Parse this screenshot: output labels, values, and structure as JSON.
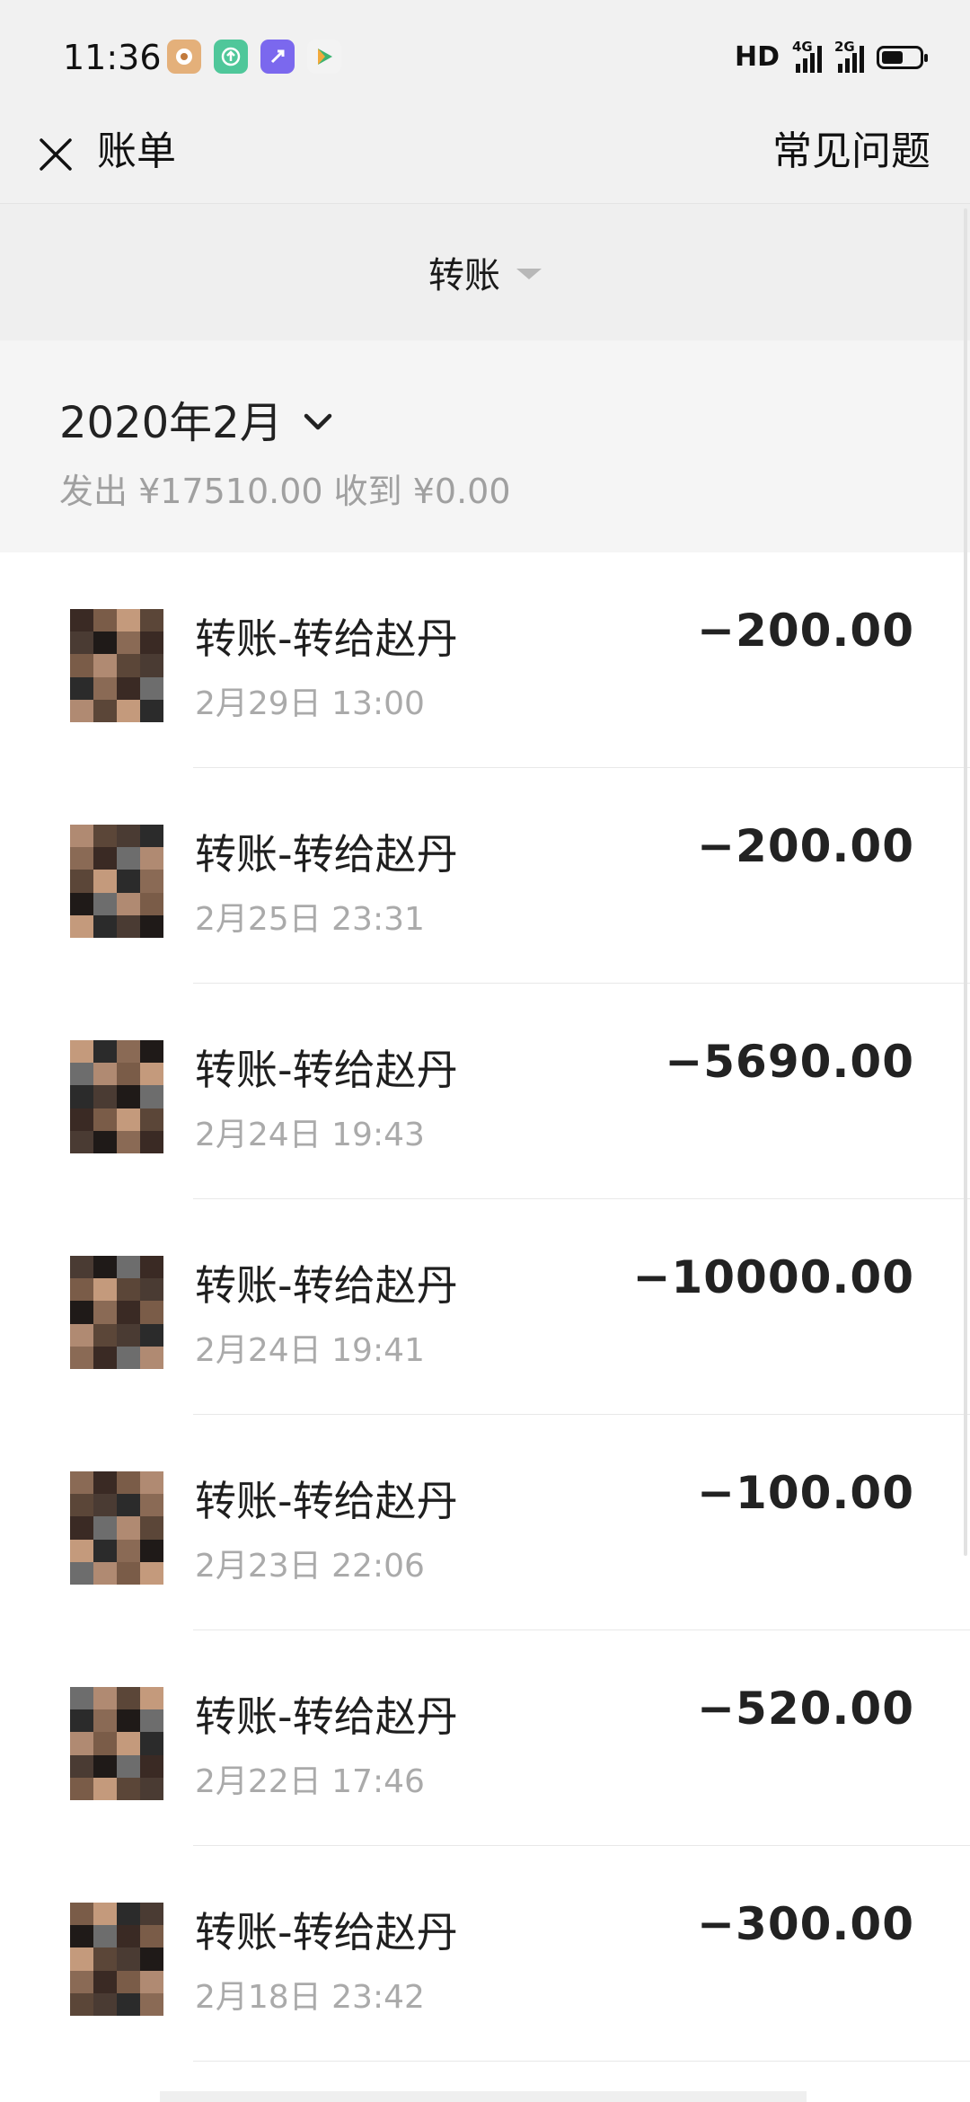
{
  "status_bar": {
    "time": "11:36",
    "app_icons": [
      "app-icon-1",
      "app-icon-2",
      "app-icon-3",
      "app-icon-4"
    ],
    "hd_label": "HD",
    "network_1": "4G",
    "network_2": "2G",
    "battery_level": 0.62
  },
  "header": {
    "title": "账单",
    "faq_label": "常见问题"
  },
  "filter": {
    "label": "转账"
  },
  "month": {
    "label": "2020年2月",
    "summary": "发出 ¥17510.00 收到 ¥0.00"
  },
  "bills": [
    {
      "title": "转账-转给赵丹",
      "time": "2月29日 13:00",
      "amount": "−200.00"
    },
    {
      "title": "转账-转给赵丹",
      "time": "2月25日 23:31",
      "amount": "−200.00"
    },
    {
      "title": "转账-转给赵丹",
      "time": "2月24日 19:43",
      "amount": "−5690.00"
    },
    {
      "title": "转账-转给赵丹",
      "time": "2月24日 19:41",
      "amount": "−10000.00"
    },
    {
      "title": "转账-转给赵丹",
      "time": "2月23日 22:06",
      "amount": "−100.00"
    },
    {
      "title": "转账-转给赵丹",
      "time": "2月22日 17:46",
      "amount": "−520.00"
    },
    {
      "title": "转账-转给赵丹",
      "time": "2月18日 23:42",
      "amount": "−300.00"
    }
  ],
  "colors": {
    "header_bg": "#f1f1f1",
    "filter_bg": "#efefef",
    "month_bg": "#f5f5f5",
    "secondary_text": "#aaaaaa"
  }
}
